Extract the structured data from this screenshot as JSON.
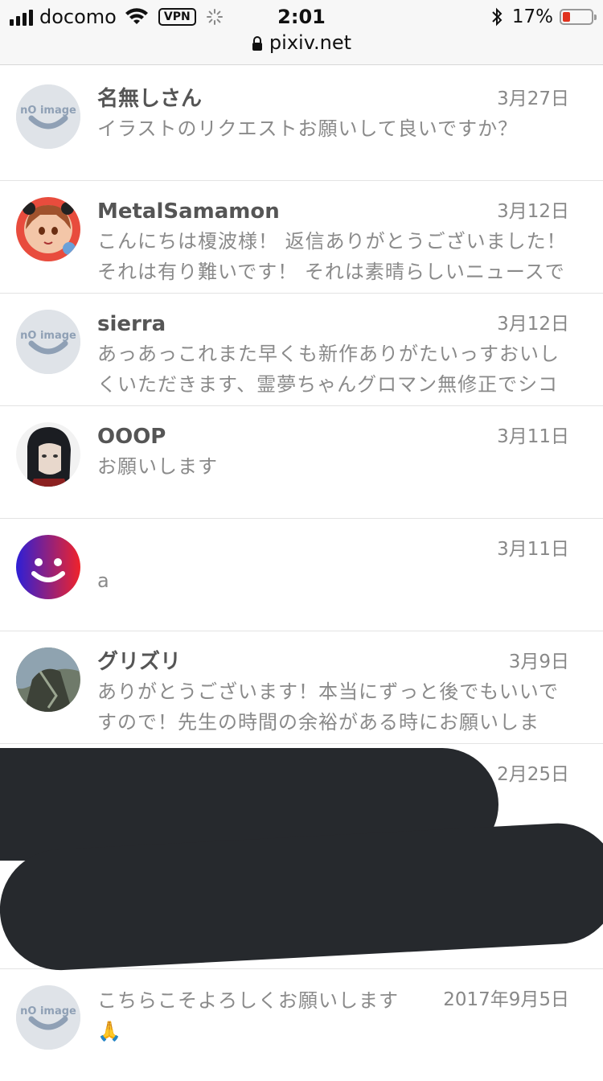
{
  "status_bar": {
    "carrier": "docomo",
    "vpn": "VPN",
    "time": "2:01",
    "battery_percent": "17%",
    "battery_level": 0.17
  },
  "browser": {
    "url": "pixiv.net"
  },
  "avatar_placeholder": {
    "top": "nO",
    "bottom": "image"
  },
  "messages": [
    {
      "name": "名無しさん",
      "date": "3月27日",
      "lines": [
        "イラストのリクエストお願いして良いですか？"
      ]
    },
    {
      "name": "MetalSamamon",
      "date": "3月12日",
      "lines": [
        "こんにちは榎波様！ 返信ありがとうございました！",
        "それは有り難いです！ それは素晴らしいニュースで"
      ]
    },
    {
      "name": "sierra",
      "date": "3月12日",
      "lines": [
        "あっあっこれまた早くも新作ありがたいっすおいし",
        "くいただきます、霊夢ちゃんグロマン無修正でシコ"
      ]
    },
    {
      "name": "OOOP",
      "date": "3月11日",
      "lines": [
        "お願いします"
      ]
    },
    {
      "name": "",
      "date": "3月11日",
      "lines": [
        "a"
      ]
    },
    {
      "name": "グリズリ",
      "date": "3月9日",
      "lines": [
        "ありがとうございます！本当にずっと後でもいいで",
        "すので！先生の時間の余裕がある時にお願いしま"
      ]
    },
    {
      "name": "",
      "date": "2月25日",
      "lines": []
    },
    {
      "name": "",
      "date": "",
      "lines": []
    },
    {
      "name": "",
      "date": "2017年9月5日",
      "lines": [
        "こちらこそよろしくお願いします",
        "🙏"
      ]
    }
  ]
}
